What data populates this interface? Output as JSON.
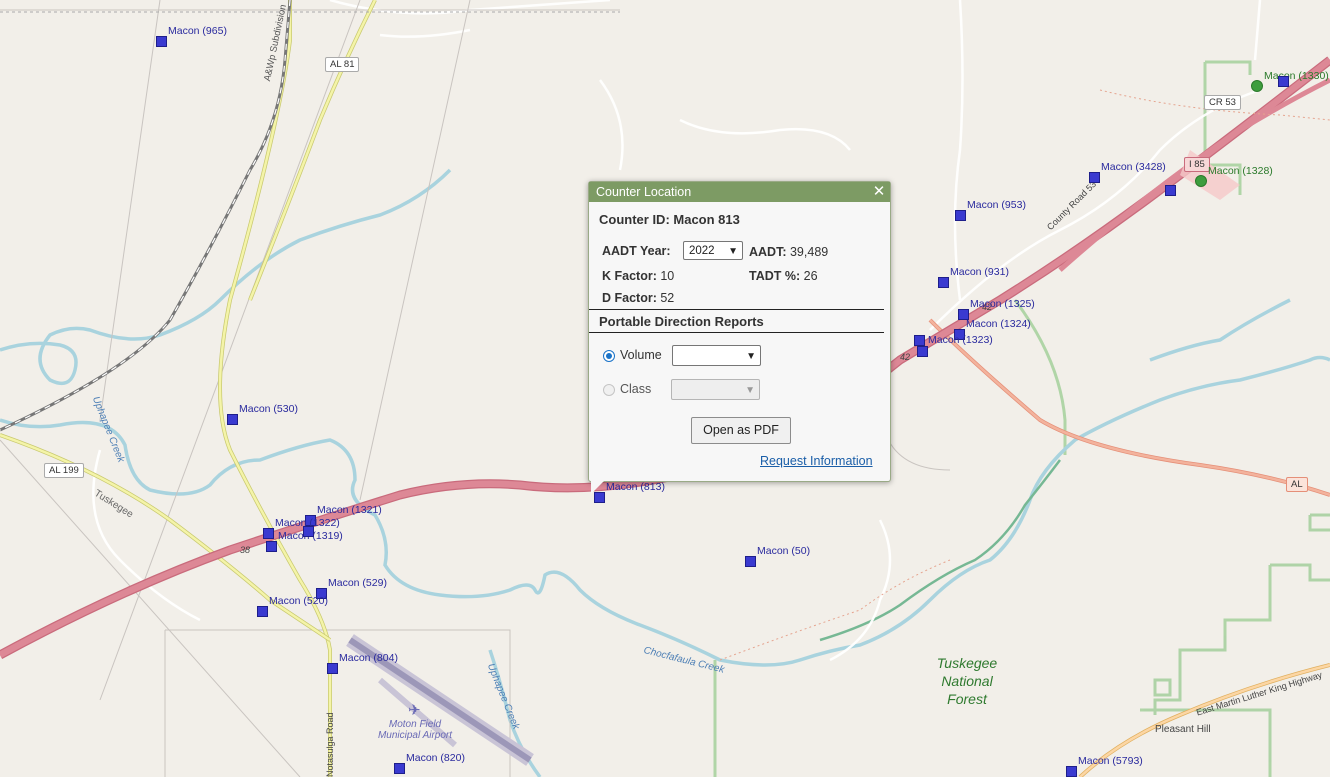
{
  "popup": {
    "title": "Counter Location",
    "close_glyph": "✕",
    "counter_id_label": "Counter ID: Macon 813",
    "aadt_year_label": "AADT Year:",
    "aadt_year_value": "2022",
    "aadt_label": "AADT:",
    "aadt_value": "39,489",
    "k_factor_label": "K Factor:",
    "k_factor_value": "10",
    "tadt_label": "TADT %:",
    "tadt_value": "26",
    "d_factor_label": "D Factor:",
    "d_factor_value": "52",
    "section_title": "Portable Direction Reports",
    "volume_label": "Volume",
    "class_label": "Class",
    "volume_selected": true,
    "open_pdf_label": "Open as PDF",
    "request_info_label": "Request Information"
  },
  "counters": [
    {
      "label": "Macon (965)"
    },
    {
      "label": "Macon (530)"
    },
    {
      "label": "Macon (1321)"
    },
    {
      "label": "Macon (1322)"
    },
    {
      "label": "Macon (1319)"
    },
    {
      "label": "Macon (529)"
    },
    {
      "label": "Macon (520)"
    },
    {
      "label": "Macon (804)"
    },
    {
      "label": "Macon (820)"
    },
    {
      "label": "Macon (813)"
    },
    {
      "label": "Macon (50)"
    },
    {
      "label": "Macon (953)"
    },
    {
      "label": "Macon (931)"
    },
    {
      "label": "Macon (1325)"
    },
    {
      "label": "Macon (1324)"
    },
    {
      "label": "Macon (1323)"
    },
    {
      "label": "Macon (3428)"
    },
    {
      "label": "Macon (1330)"
    },
    {
      "label": "Macon (1328)"
    },
    {
      "label": "Macon (5793)"
    }
  ],
  "road_shields": {
    "al81": "AL 81",
    "al199": "AL 199",
    "cr53": "CR 53",
    "i85": "I 85",
    "al": "AL"
  },
  "labels": {
    "railroad": "A&Wp Subdivision",
    "uphapee_creek": "Uphapee Creek",
    "uphapee_creek_2": "Uphapee Creek",
    "chocfafaula_creek": "Chocfafaula Creek",
    "tuskegee": "Tuskegee",
    "forest": "Tuskegee National Forest",
    "county_road": "County Road 53",
    "mlk_highway": "East Martin Luther King Highway",
    "pleasant_hill": "Pleasant Hill",
    "notasulga_road": "Notasulga Road",
    "airport": "Moton Field Municipal Airport",
    "route_38": "38",
    "route_42": "42",
    "route_42b": "42"
  },
  "colors": {
    "interstate": "#dd8896",
    "water": "#a9d3de",
    "secondary": "#f2f29a",
    "forest_border": "#a8d1a0",
    "popup_header": "#7d9b64",
    "marker": "#3a3ad0",
    "marker_green": "#3e9d3e"
  }
}
